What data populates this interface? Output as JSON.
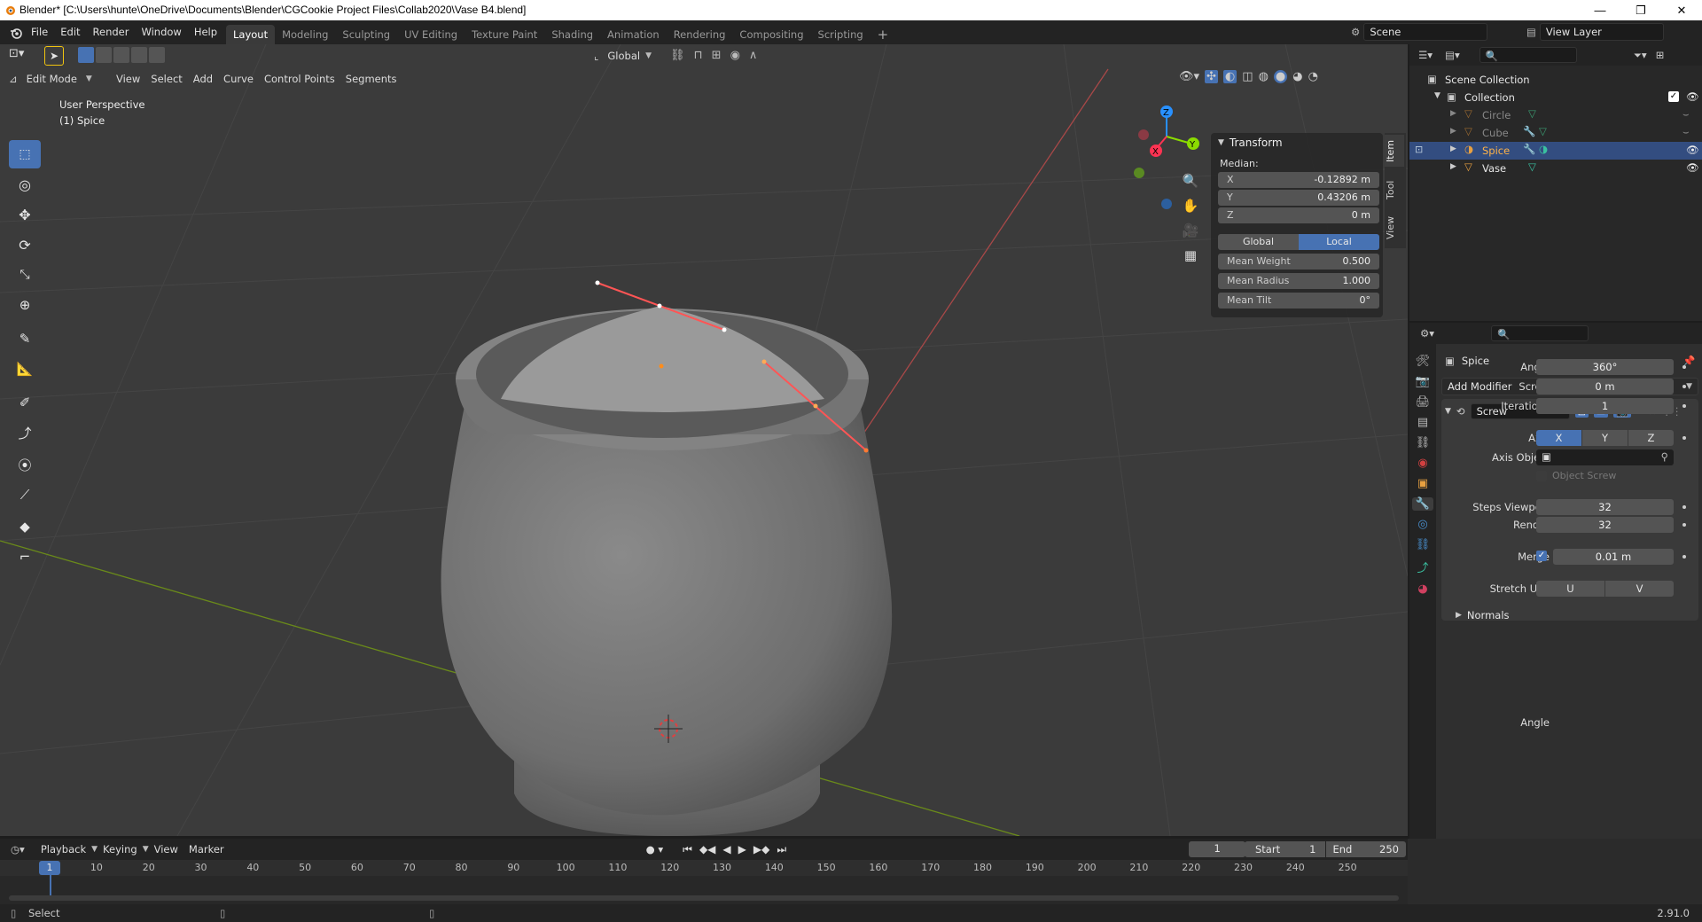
{
  "window": {
    "title": "Blender* [C:\\Users\\hunte\\OneDrive\\Documents\\Blender\\CGCookie Project Files\\Collab2020\\Vase B4.blend]",
    "minimize": "—",
    "maximize": "❐",
    "close": "✕"
  },
  "menu": [
    "File",
    "Edit",
    "Render",
    "Window",
    "Help"
  ],
  "workspaces": [
    "Layout",
    "Modeling",
    "Sculpting",
    "UV Editing",
    "Texture Paint",
    "Shading",
    "Animation",
    "Rendering",
    "Compositing",
    "Scripting"
  ],
  "scene": {
    "label": "Scene",
    "view_layer": "View Layer"
  },
  "viewport": {
    "transform_orientation": "Global",
    "mode": "Edit Mode",
    "header_menus": [
      "View",
      "Select",
      "Add",
      "Curve",
      "Control Points",
      "Segments"
    ],
    "overlay_title": "User Perspective",
    "overlay_object": "(1) Spice",
    "gizmo_axes": {
      "z": "Z",
      "y": "Y",
      "x": "X"
    },
    "colors": {
      "x_axis": "#ff3352",
      "y_axis": "#8bdc00",
      "z_axis": "#2890ff",
      "active": "#4772b3"
    }
  },
  "npanel": {
    "section": "Transform",
    "median_label": "Median:",
    "x_label": "X",
    "x_value": "-0.12892 m",
    "y_label": "Y",
    "y_value": "0.43206 m",
    "z_label": "Z",
    "z_value": "0 m",
    "global": "Global",
    "local": "Local",
    "mean_weight_label": "Mean Weight",
    "mean_weight": "0.500",
    "mean_radius_label": "Mean Radius",
    "mean_radius": "1.000",
    "mean_tilt_label": "Mean Tilt",
    "mean_tilt": "0°",
    "tabs": [
      "Item",
      "Tool",
      "View"
    ]
  },
  "outliner": {
    "root": "Scene Collection",
    "collection": "Collection",
    "items": [
      {
        "name": "Circle"
      },
      {
        "name": "Cube"
      },
      {
        "name": "Spice"
      },
      {
        "name": "Vase"
      }
    ]
  },
  "properties": {
    "object_name": "Spice",
    "add_modifier": "Add Modifier",
    "modifier_name": "Screw",
    "angle_label": "Angle",
    "angle": "360°",
    "screw_label": "Screw",
    "screw": "0 m",
    "iterations_label": "Iterations",
    "iterations": "1",
    "axis_label": "Axis",
    "axis_x": "X",
    "axis_y": "Y",
    "axis_z": "Z",
    "axis_object_label": "Axis Object",
    "object_screw_label": "Object Screw",
    "steps_viewport_label": "Steps Viewport",
    "steps_viewport": "32",
    "render_label": "Render",
    "render": "32",
    "merge_label": "Merge",
    "merge": "0.01 m",
    "stretch_uvs_label": "Stretch UVs",
    "stretch_u": "U",
    "stretch_v": "V",
    "normals_label": "Normals"
  },
  "timeline": {
    "menus": [
      "Playback",
      "Keying",
      "View",
      "Marker"
    ],
    "current_frame": "1",
    "start_label": "Start",
    "start": "1",
    "end_label": "End",
    "end": "250",
    "ticks": [
      "1",
      "10",
      "20",
      "30",
      "40",
      "50",
      "60",
      "70",
      "80",
      "90",
      "100",
      "110",
      "120",
      "130",
      "140",
      "150",
      "160",
      "170",
      "180",
      "190",
      "200",
      "210",
      "220",
      "230",
      "240",
      "250"
    ]
  },
  "statusbar": {
    "left": "Select",
    "version": "2.91.0"
  }
}
